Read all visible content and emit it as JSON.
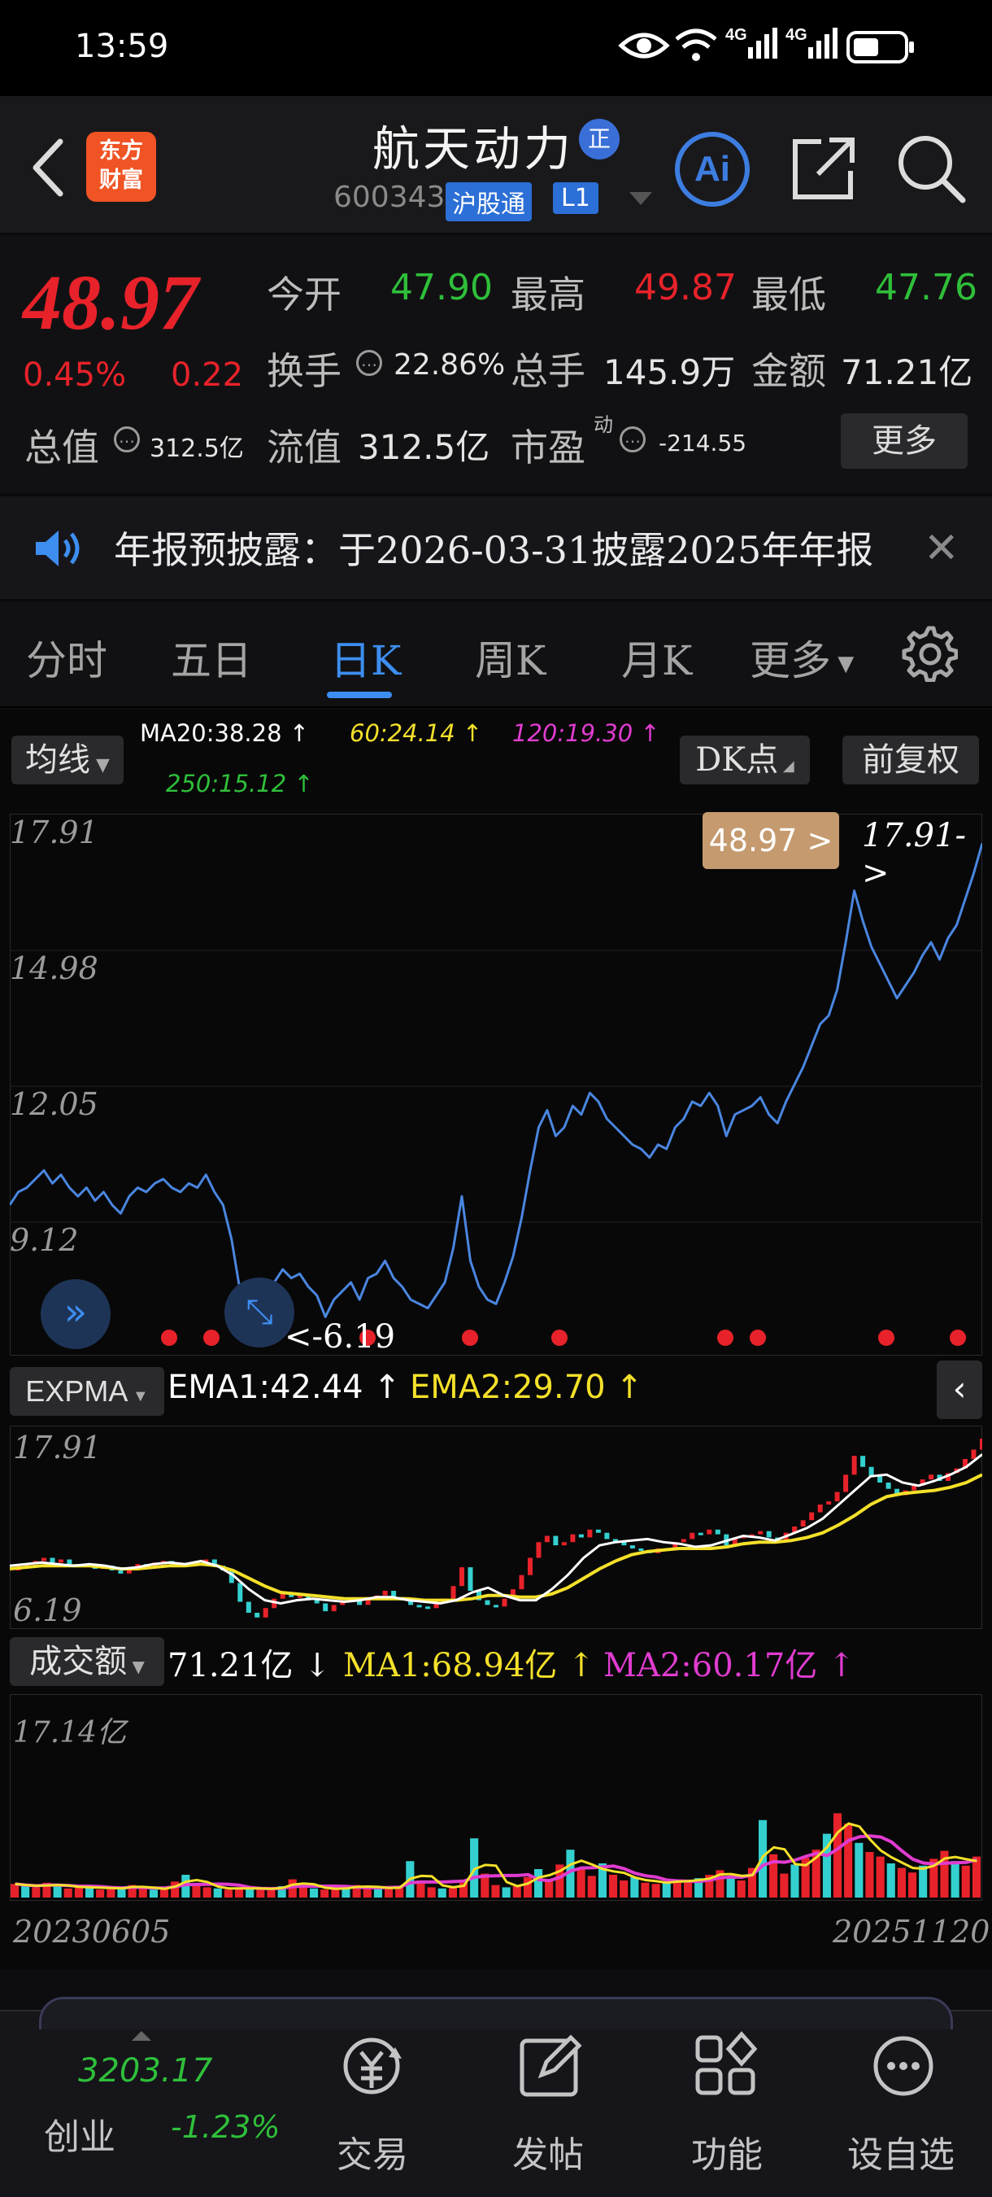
{
  "status_bar": {
    "time": "13:59",
    "net1": "4G",
    "net2": "4G"
  },
  "header": {
    "logo_line1": "东方",
    "logo_line2": "财富",
    "stock_name": "航天动力",
    "badge": "正",
    "code": "600343",
    "hgt": "沪股通",
    "level": "L1",
    "ai_label": "Ai"
  },
  "quote": {
    "price": "48.97",
    "change_pct": "0.45%",
    "change": "0.22",
    "open_label": "今开",
    "open": "47.90",
    "high_label": "最高",
    "high": "49.87",
    "low_label": "最低",
    "low": "47.76",
    "turnover_label": "换手",
    "turnover": "22.86%",
    "volume_label": "总手",
    "volume": "145.9万",
    "amount_label": "金额",
    "amount": "71.21亿",
    "mktcap_label": "总值",
    "mktcap": "312.5亿",
    "float_label": "流值",
    "float_cap": "312.5亿",
    "pe_label": "市盈",
    "pe_sup": "动",
    "pe": "-214.55",
    "more_label": "更多"
  },
  "notice": {
    "text": "年报预披露：于2026-03-31披露2025年年报"
  },
  "tabs": [
    "分时",
    "五日",
    "日K",
    "周K",
    "月K",
    "更多"
  ],
  "active_tab": 2,
  "chart": {
    "ma_button": "均线",
    "ma20": "MA20:38.28",
    "ma60": "60:24.14",
    "ma120": "120:19.30",
    "ma250": "250:15.12",
    "dk_button": "DK点",
    "adjust_button": "前复权",
    "price_bubble": "48.97 >",
    "high_marker": "17.91->",
    "low_marker": "<-6.19",
    "expma_button": "EXPMA",
    "ema1": "EMA1:42.44",
    "ema2": "EMA2:29.70",
    "vol_button": "成交额",
    "vol_value": "71.21亿",
    "vol_ma1": "MA1:68.94亿",
    "vol_ma2": "MA2:60.17亿",
    "vol_max": "17.14亿",
    "date_start": "20230605",
    "date_end": "20251120",
    "colors": {
      "line": "#4a86e0",
      "ema1": "#ffffff",
      "ema2": "#f4e02a",
      "ma1": "#f4e02a",
      "ma2": "#e03cd0",
      "up": "#e8222a",
      "down": "#34d0d0"
    }
  },
  "chart_data": {
    "type": "line",
    "ylim": [
      6.19,
      17.91
    ],
    "yticks": [
      "17.91",
      "14.98",
      "12.05",
      "9.12",
      "6.19"
    ],
    "ema_yticks": [
      "17.91",
      "6.19"
    ],
    "series": [],
    "values": [
      9.2,
      9.5,
      9.6,
      9.8,
      10.0,
      9.7,
      9.9,
      9.6,
      9.4,
      9.6,
      9.3,
      9.5,
      9.2,
      9.0,
      9.4,
      9.6,
      9.5,
      9.7,
      9.8,
      9.6,
      9.5,
      9.7,
      9.6,
      9.9,
      9.5,
      9.2,
      8.4,
      7.2,
      6.5,
      6.2,
      6.8,
      7.4,
      7.7,
      7.5,
      7.6,
      7.3,
      7.1,
      6.6,
      7.0,
      7.2,
      7.4,
      7.0,
      7.5,
      7.6,
      7.9,
      7.5,
      7.3,
      7.0,
      6.9,
      6.8,
      7.1,
      7.4,
      8.2,
      9.4,
      7.9,
      7.3,
      7.0,
      6.9,
      7.4,
      8.0,
      8.9,
      10.0,
      11.0,
      11.4,
      10.8,
      11.0,
      11.5,
      11.3,
      11.8,
      11.6,
      11.2,
      11.0,
      10.8,
      10.6,
      10.5,
      10.3,
      10.6,
      10.5,
      11.0,
      11.2,
      11.6,
      11.5,
      11.8,
      11.5,
      10.8,
      11.3,
      11.4,
      11.5,
      11.7,
      11.3,
      11.1,
      11.6,
      12.0,
      12.4,
      12.9,
      13.4,
      13.6,
      14.2,
      15.3,
      16.5,
      15.8,
      15.2,
      14.8,
      14.4,
      14.0,
      14.3,
      14.6,
      15.0,
      15.3,
      14.9,
      15.4,
      15.7,
      16.3,
      16.9,
      17.6
    ],
    "ema1": [
      9.5,
      9.6,
      9.7,
      9.6,
      9.5,
      9.6,
      9.5,
      9.3,
      9.4,
      9.6,
      9.7,
      9.6,
      9.8,
      9.5,
      8.9,
      8.0,
      7.3,
      7.1,
      7.3,
      7.4,
      7.3,
      7.2,
      7.3,
      7.5,
      7.5,
      7.3,
      7.2,
      7.1,
      7.3,
      7.8,
      8.1,
      7.6,
      7.3,
      7.3,
      8.0,
      8.9,
      10.0,
      10.8,
      11.0,
      11.1,
      11.2,
      11.0,
      10.9,
      10.7,
      10.8,
      11.1,
      11.4,
      11.3,
      11.1,
      11.5,
      11.9,
      12.5,
      13.4,
      14.3,
      15.2,
      15.3,
      14.8,
      14.6,
      14.9,
      15.3,
      15.8,
      16.6
    ],
    "ema2": [
      9.3,
      9.4,
      9.5,
      9.5,
      9.5,
      9.5,
      9.4,
      9.3,
      9.3,
      9.4,
      9.5,
      9.5,
      9.6,
      9.5,
      9.2,
      8.7,
      8.2,
      7.8,
      7.7,
      7.6,
      7.5,
      7.4,
      7.4,
      7.4,
      7.4,
      7.4,
      7.3,
      7.3,
      7.3,
      7.4,
      7.6,
      7.6,
      7.5,
      7.5,
      7.7,
      8.1,
      8.7,
      9.3,
      9.8,
      10.2,
      10.4,
      10.5,
      10.6,
      10.6,
      10.6,
      10.7,
      10.9,
      11.0,
      11.0,
      11.1,
      11.3,
      11.6,
      12.1,
      12.7,
      13.4,
      13.9,
      14.1,
      14.2,
      14.3,
      14.5,
      14.8,
      15.3
    ],
    "volume": [
      1.2,
      1.0,
      0.9,
      1.3,
      1.1,
      0.8,
      0.9,
      1.0,
      0.7,
      0.8,
      0.9,
      1.1,
      0.8,
      0.7,
      0.8,
      1.4,
      2.0,
      1.2,
      0.9,
      0.8,
      0.7,
      0.9,
      0.8,
      0.7,
      0.8,
      1.0,
      1.6,
      1.1,
      0.8,
      0.7,
      0.8,
      0.9,
      1.1,
      0.9,
      0.8,
      0.8,
      1.0,
      3.2,
      1.5,
      0.9,
      0.8,
      1.0,
      1.3,
      5.2,
      2.1,
      1.1,
      0.9,
      1.0,
      1.8,
      2.5,
      1.6,
      2.9,
      4.2,
      2.6,
      1.9,
      3.0,
      2.0,
      1.5,
      1.8,
      1.3,
      1.2,
      1.4,
      1.6,
      1.3,
      1.7,
      2.0,
      2.4,
      1.8,
      1.5,
      2.6,
      6.8,
      3.8,
      2.1,
      2.9,
      3.5,
      4.2,
      5.6,
      7.4,
      6.5,
      4.8,
      4.0,
      3.6,
      3.0,
      2.6,
      2.2,
      2.8,
      3.4,
      4.1,
      3.2,
      2.8,
      3.6
    ]
  },
  "kline_dots": 10,
  "bottom_nav": {
    "index_value": "3203.17",
    "index_name": "创业",
    "index_change": "-1.23%",
    "items": [
      "交易",
      "发帖",
      "功能",
      "设自选"
    ]
  }
}
